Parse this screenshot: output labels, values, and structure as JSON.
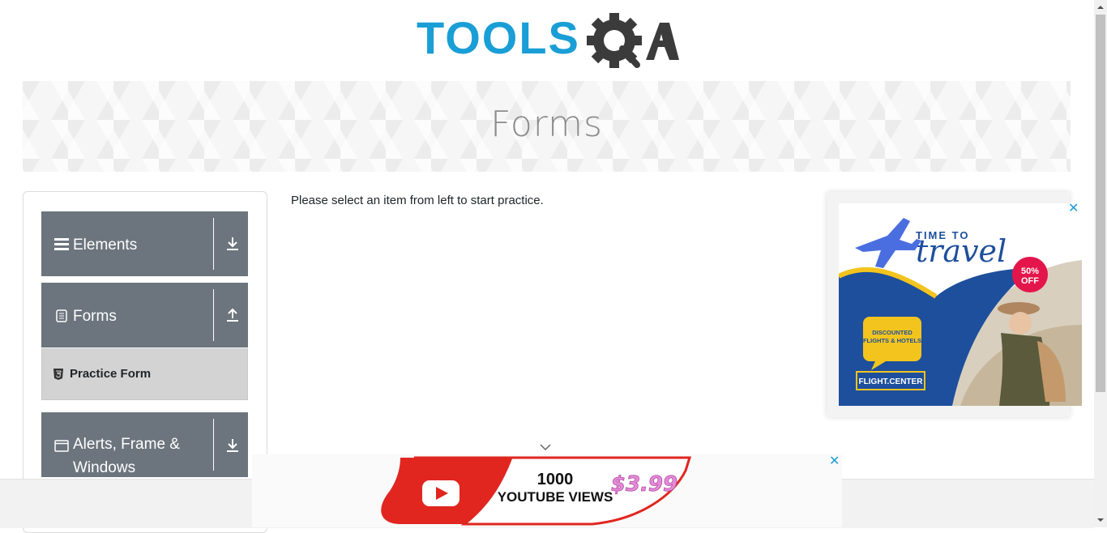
{
  "header": {
    "logo_tools": "TOOLS",
    "logo_qa": "QA",
    "colors": {
      "tools": "#1a9ed6",
      "qa": "#3b3b3b"
    }
  },
  "banner": {
    "title": "Forms"
  },
  "sidebar": {
    "groups": [
      {
        "label": "Elements",
        "icon": "hamburger-icon",
        "arrow": "download-arrow-icon"
      },
      {
        "label": "Forms",
        "icon": "document-icon",
        "arrow": "upload-arrow-icon"
      },
      {
        "label": "Alerts, Frame &",
        "label2": "Windows",
        "icon": "window-icon",
        "arrow": "download-arrow-icon"
      }
    ],
    "sub_items": [
      {
        "label": "Practice Form",
        "icon": "html5-icon"
      }
    ],
    "colors": {
      "group_bg": "#6c757d",
      "active_item_bg": "#d3d3d3"
    }
  },
  "main": {
    "message": "Please select an item from left to start practice."
  },
  "ads": {
    "right": {
      "line1": "TIME TO",
      "line2": "travel",
      "badge_pct": "50%",
      "badge_off": "OFF",
      "bubble1": "DISCOUNTED",
      "bubble2": "FLIGHTS & HOTELS",
      "brand": "FLIGHT.CENTER",
      "close": "✕"
    },
    "bottom": {
      "line1": "1000",
      "line2": "YOUTUBE VIEWS",
      "price": "$3.99",
      "close": "✕"
    }
  }
}
